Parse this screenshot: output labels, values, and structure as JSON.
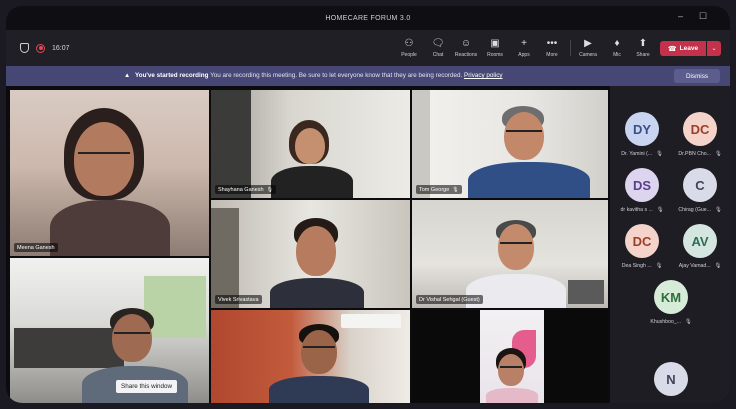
{
  "window": {
    "title": "HOMECARE FORUM 3.0",
    "minimize": "–",
    "maximize": "☐"
  },
  "toolbar": {
    "time": "16:07",
    "buttons": [
      {
        "label": "People",
        "icon": "people-icon",
        "glyph": "⚇"
      },
      {
        "label": "Chat",
        "icon": "chat-icon",
        "glyph": "🗨"
      },
      {
        "label": "Reactions",
        "icon": "reactions-icon",
        "glyph": "☺"
      },
      {
        "label": "Rooms",
        "icon": "rooms-icon",
        "glyph": "▣"
      },
      {
        "label": "Apps",
        "icon": "apps-icon",
        "glyph": "+"
      },
      {
        "label": "More",
        "icon": "more-icon",
        "glyph": "•••"
      },
      {
        "label": "Camera",
        "icon": "camera-icon",
        "glyph": "▶"
      },
      {
        "label": "Mic",
        "icon": "mic-icon",
        "glyph": "♦"
      },
      {
        "label": "Share",
        "icon": "share-icon",
        "glyph": "⬆"
      }
    ],
    "leave_label": "Leave",
    "leave_glyph": "☎",
    "leave_dropdown": "⌄"
  },
  "banner": {
    "icon_glyph": "▲",
    "title": "You've started recording",
    "message": "You are recording this meeting. Be sure to let everyone know that they are being recorded.",
    "link": "Privacy policy",
    "dismiss": "Dismiss"
  },
  "tiles": [
    {
      "name": "Meena Ganesh",
      "mic": ""
    },
    {
      "name": "Shayhana Ganesh",
      "mic": "🎙"
    },
    {
      "name": "Tom George",
      "mic": "🎙"
    },
    {
      "name": "Vivek Srivastava",
      "mic": ""
    },
    {
      "name": "Dr Vishal Sehgal (Guest)",
      "mic": ""
    },
    {
      "name": "",
      "mic": ""
    },
    {
      "name": "",
      "mic": ""
    },
    {
      "name": "",
      "mic": ""
    }
  ],
  "share_tooltip": "Share this window",
  "participants": [
    {
      "initials": "DY",
      "name": "Dr. Yamini (...",
      "bg": "#c9d4f0",
      "fg": "#3b4f87"
    },
    {
      "initials": "DC",
      "name": "Dr.PBN Cho...",
      "bg": "#f3d3ca",
      "fg": "#9c3e2a"
    },
    {
      "initials": "DS",
      "name": "dr kavitha s ...",
      "bg": "#ddd4ef",
      "fg": "#5a3e8a"
    },
    {
      "initials": "C",
      "name": "Chirag (Gue...",
      "bg": "#d9dbe8",
      "fg": "#3f4358"
    },
    {
      "initials": "DC",
      "name": "Dea Singh ...",
      "bg": "#f3d3ca",
      "fg": "#9c3e2a"
    },
    {
      "initials": "AV",
      "name": "Ajay Vamad...",
      "bg": "#d4e6df",
      "fg": "#2f6b56"
    },
    {
      "initials": "KM",
      "name": "Khushboo_...",
      "bg": "#d6ecd8",
      "fg": "#2e6e3a"
    },
    {
      "initials": "N",
      "name": "",
      "bg": "#d9dbe8",
      "fg": "#3f4358"
    }
  ],
  "participant_mic_glyph": "🎙"
}
